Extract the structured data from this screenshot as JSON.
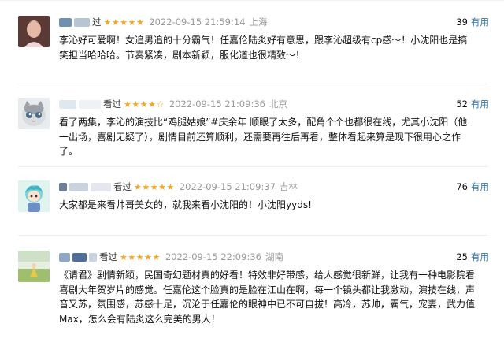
{
  "reviews": [
    {
      "verb": "过",
      "stars": "★★★★★",
      "time": "2022-09-15 21:59:14",
      "location": "上海",
      "votes": "39",
      "useful_label": "有用",
      "content": "李沁好可爱啊！女追男追的十分霸气！任嘉伦陆炎好有意思，跟李沁超级有cp感～！小沈阳也是搞笑担当哈哈哈。节奏紧凑，剧本新颖，服化道也很精致～！"
    },
    {
      "verb": "看过",
      "stars": "★★★★☆",
      "time": "2022-09-15 21:09:36",
      "location": "北京",
      "votes": "52",
      "useful_label": "有用",
      "content": "看了两集，李沁的演技比“鸡腿姑娘”#庆余年 顺眼了太多，配角个个也都很在线，尤其小沈阳（他一出场，喜剧无疑了），剧情目前还算顺利，还需要再往后再看，整体看起来算是现下很用心之作了。"
    },
    {
      "verb": "看过",
      "stars": "★★★★★",
      "time": "2022-09-15 21:09:37",
      "location": "吉林",
      "votes": "76",
      "useful_label": "有用",
      "content": "大家都是来看帅哥美女的，就我来看小沈阳的！小沈阳yyds!"
    },
    {
      "verb": "看过",
      "stars": "★★★★★",
      "time": "2022-09-15 22:09:36",
      "location": "湖南",
      "votes": "25",
      "useful_label": "有用",
      "content": "《请君》剧情新颖，民国奇幻题材真的好看！特效非好带感，给人感觉很新鲜，让我有一种电影院看喜剧大年贺岁片的感觉。任嘉伦这个脸真的是脸在江山在啊，每一个镜头都让我激动，演技在线，声音又苏，氛围感，苏感十足，沉沦于任嘉伦的眼神中已不可自拔！高冷，苏帅，霸气，宠妻，武力值Max，怎么会有陆炎这么完美的男人！"
    }
  ],
  "colors": {
    "star": "#f5a623",
    "useful_link": "#3377aa",
    "meta_gray": "#9a9a9a"
  }
}
